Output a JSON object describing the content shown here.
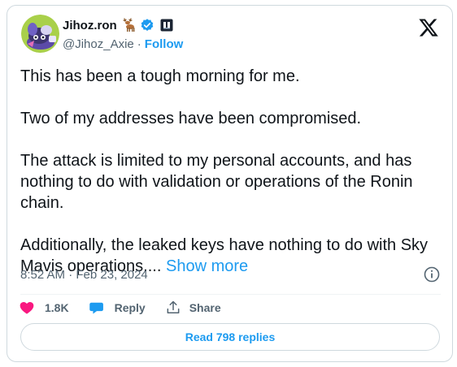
{
  "author": {
    "display_name": "Jihoz.ron",
    "handle": "@Jihoz_Axie",
    "separator": "·",
    "follow_label": "Follow",
    "name_emoji": "deer-icon",
    "verified": "verified-badge-icon",
    "affiliate": "affiliate-badge-icon"
  },
  "tweet": {
    "paragraphs": [
      "This has been a tough morning for me.",
      "Two of my addresses have been compromised.",
      "The attack is limited to my personal accounts, and has nothing to do with validation or operations of the Ronin chain."
    ],
    "last_paragraph": "Additionally, the leaked keys have nothing to do with Sky Mavis operations....",
    "show_more_label": "Show more"
  },
  "meta": {
    "timestamp": "8:52 AM · Feb 23, 2024"
  },
  "actions": {
    "likes": "1.8K",
    "reply_label": "Reply",
    "share_label": "Share"
  },
  "read_replies_label": "Read 798 replies",
  "colors": {
    "accent": "#1d9bf0",
    "like": "#f91880",
    "text": "#0f1419",
    "secondary": "#536471",
    "border": "#cfd9de"
  }
}
